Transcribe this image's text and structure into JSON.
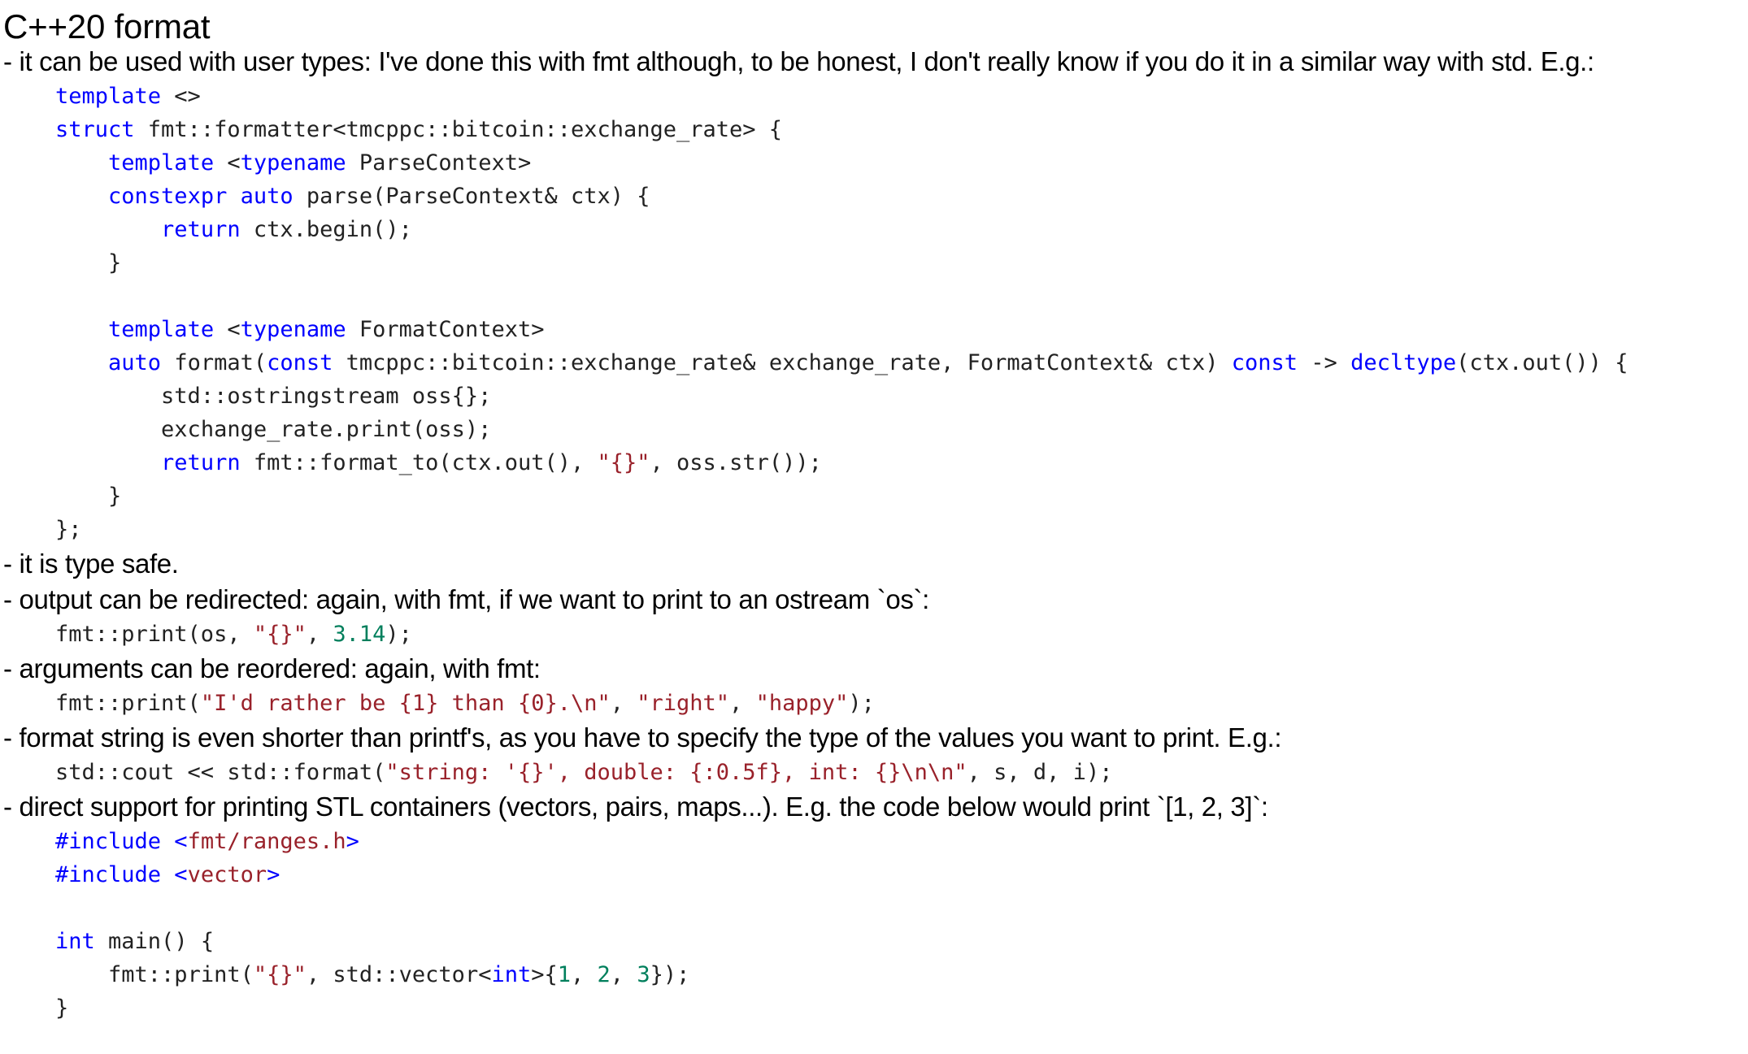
{
  "slide": {
    "title": "C++20 format"
  },
  "content": [
    {
      "kind": "bullet",
      "text": "- it can be used with user types: I've done this with fmt although, to be honest, I don't really know if you do it in a similar way with std. E.g.:"
    },
    {
      "kind": "code",
      "indent": 0,
      "tokens": [
        {
          "t": "template",
          "c": "kw"
        },
        {
          "t": " <>",
          "c": "plain"
        }
      ]
    },
    {
      "kind": "code",
      "indent": 0,
      "tokens": [
        {
          "t": "struct",
          "c": "kw"
        },
        {
          "t": " fmt::formatter<tmcppc::bitcoin::exchange_rate> {",
          "c": "plain"
        }
      ]
    },
    {
      "kind": "code",
      "indent": 1,
      "tokens": [
        {
          "t": "template",
          "c": "kw"
        },
        {
          "t": " <",
          "c": "plain"
        },
        {
          "t": "typename",
          "c": "kw"
        },
        {
          "t": " ParseContext>",
          "c": "plain"
        }
      ]
    },
    {
      "kind": "code",
      "indent": 1,
      "tokens": [
        {
          "t": "constexpr",
          "c": "kw"
        },
        {
          "t": " ",
          "c": "plain"
        },
        {
          "t": "auto",
          "c": "kw"
        },
        {
          "t": " parse(ParseContext& ctx) {",
          "c": "plain"
        }
      ]
    },
    {
      "kind": "code",
      "indent": 2,
      "tokens": [
        {
          "t": "return",
          "c": "kw"
        },
        {
          "t": " ctx.begin();",
          "c": "plain"
        }
      ]
    },
    {
      "kind": "code",
      "indent": 1,
      "tokens": [
        {
          "t": "}",
          "c": "plain"
        }
      ]
    },
    {
      "kind": "code",
      "indent": 0,
      "tokens": [
        {
          "t": "",
          "c": "plain"
        }
      ]
    },
    {
      "kind": "code",
      "indent": 1,
      "tokens": [
        {
          "t": "template",
          "c": "kw"
        },
        {
          "t": " <",
          "c": "plain"
        },
        {
          "t": "typename",
          "c": "kw"
        },
        {
          "t": " FormatContext>",
          "c": "plain"
        }
      ]
    },
    {
      "kind": "code",
      "indent": 1,
      "tokens": [
        {
          "t": "auto",
          "c": "kw"
        },
        {
          "t": " format(",
          "c": "plain"
        },
        {
          "t": "const",
          "c": "kw"
        },
        {
          "t": " tmcppc::bitcoin::exchange_rate& exchange_rate, FormatContext& ctx) ",
          "c": "plain"
        },
        {
          "t": "const",
          "c": "kw"
        },
        {
          "t": " -> ",
          "c": "plain"
        },
        {
          "t": "decltype",
          "c": "kw"
        },
        {
          "t": "(ctx.out()) {",
          "c": "plain"
        }
      ]
    },
    {
      "kind": "code",
      "indent": 2,
      "tokens": [
        {
          "t": "std::ostringstream oss{};",
          "c": "plain"
        }
      ]
    },
    {
      "kind": "code",
      "indent": 2,
      "tokens": [
        {
          "t": "exchange_rate.print(oss);",
          "c": "plain"
        }
      ]
    },
    {
      "kind": "code",
      "indent": 2,
      "tokens": [
        {
          "t": "return",
          "c": "kw"
        },
        {
          "t": " fmt::format_to(ctx.out(), ",
          "c": "plain"
        },
        {
          "t": "\"{}\"",
          "c": "str"
        },
        {
          "t": ", oss.str());",
          "c": "plain"
        }
      ]
    },
    {
      "kind": "code",
      "indent": 1,
      "tokens": [
        {
          "t": "}",
          "c": "plain"
        }
      ]
    },
    {
      "kind": "code",
      "indent": 0,
      "tokens": [
        {
          "t": "};",
          "c": "plain"
        }
      ]
    },
    {
      "kind": "bullet",
      "text": "- it is type safe."
    },
    {
      "kind": "bullet",
      "text": "- output can be redirected: again, with fmt, if we want to print to an ostream `os`:"
    },
    {
      "kind": "code",
      "indent": 0,
      "tokens": [
        {
          "t": "fmt::print(os, ",
          "c": "plain"
        },
        {
          "t": "\"{}\"",
          "c": "str"
        },
        {
          "t": ", ",
          "c": "plain"
        },
        {
          "t": "3.14",
          "c": "num"
        },
        {
          "t": ");",
          "c": "plain"
        }
      ]
    },
    {
      "kind": "bullet",
      "text": "- arguments can be reordered: again, with fmt:"
    },
    {
      "kind": "code",
      "indent": 0,
      "tokens": [
        {
          "t": "fmt::print(",
          "c": "plain"
        },
        {
          "t": "\"I'd rather be {1} than {0}.\\n\"",
          "c": "str"
        },
        {
          "t": ", ",
          "c": "plain"
        },
        {
          "t": "\"right\"",
          "c": "str"
        },
        {
          "t": ", ",
          "c": "plain"
        },
        {
          "t": "\"happy\"",
          "c": "str"
        },
        {
          "t": ");",
          "c": "plain"
        }
      ]
    },
    {
      "kind": "bullet",
      "text": "- format string is even shorter than printf's, as you have to specify the type of the values you want to print. E.g.:"
    },
    {
      "kind": "code",
      "indent": 0,
      "tokens": [
        {
          "t": "std::cout << std::format(",
          "c": "plain"
        },
        {
          "t": "\"string: '{}', double: {:0.5f}, int: {}\\n\\n\"",
          "c": "str"
        },
        {
          "t": ", s, d, i);",
          "c": "plain"
        }
      ]
    },
    {
      "kind": "bullet",
      "text": "- direct support for printing STL containers (vectors, pairs, maps...). E.g. the code below would print `[1, 2, 3]`:"
    },
    {
      "kind": "code",
      "indent": 0,
      "tokens": [
        {
          "t": "#include",
          "c": "pp"
        },
        {
          "t": " <",
          "c": "kw"
        },
        {
          "t": "fmt/ranges.h",
          "c": "hdr"
        },
        {
          "t": ">",
          "c": "kw"
        }
      ]
    },
    {
      "kind": "code",
      "indent": 0,
      "tokens": [
        {
          "t": "#include",
          "c": "pp"
        },
        {
          "t": " <",
          "c": "kw"
        },
        {
          "t": "vector",
          "c": "hdr"
        },
        {
          "t": ">",
          "c": "kw"
        }
      ]
    },
    {
      "kind": "code",
      "indent": 0,
      "tokens": [
        {
          "t": "",
          "c": "plain"
        }
      ]
    },
    {
      "kind": "code",
      "indent": 0,
      "tokens": [
        {
          "t": "int",
          "c": "kw"
        },
        {
          "t": " main() {",
          "c": "plain"
        }
      ]
    },
    {
      "kind": "code",
      "indent": 1,
      "tokens": [
        {
          "t": "fmt::print(",
          "c": "plain"
        },
        {
          "t": "\"{}\"",
          "c": "str"
        },
        {
          "t": ", std::vector<",
          "c": "plain"
        },
        {
          "t": "int",
          "c": "kw"
        },
        {
          "t": ">{",
          "c": "plain"
        },
        {
          "t": "1",
          "c": "num"
        },
        {
          "t": ", ",
          "c": "plain"
        },
        {
          "t": "2",
          "c": "num"
        },
        {
          "t": ", ",
          "c": "plain"
        },
        {
          "t": "3",
          "c": "num"
        },
        {
          "t": "});",
          "c": "plain"
        }
      ]
    },
    {
      "kind": "code",
      "indent": 0,
      "tokens": [
        {
          "t": "}",
          "c": "plain"
        }
      ]
    }
  ],
  "colors": {
    "background": "#ffffff",
    "text": "#000000",
    "code_text": "#222222",
    "keyword": "#0000ff",
    "string": "#99212a",
    "number": "#007f5c",
    "preprocessor": "#0000ff",
    "header_path": "#99212a"
  }
}
